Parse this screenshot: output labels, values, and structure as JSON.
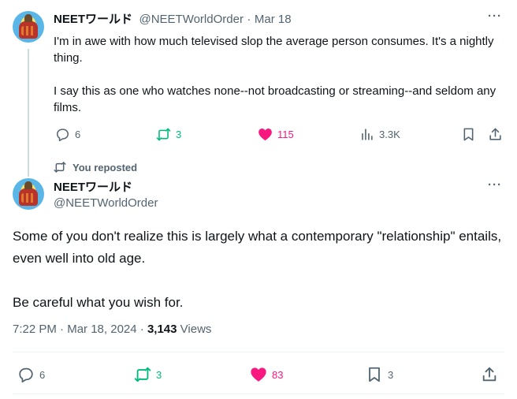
{
  "tweet1": {
    "author_name": "NEETワールド",
    "author_handle": "@NEETWorldOrder",
    "separator": "·",
    "date": "Mar 18",
    "more_icon": "more-icon",
    "paragraphs": [
      "I'm in awe with how much televised slop the average person consumes. It's a nightly thing.",
      "I say this as one who watches none--not broadcasting or streaming--and seldom any films."
    ],
    "actions": {
      "replies": "6",
      "reposts": "3",
      "likes": "115",
      "views": "3.3K"
    },
    "colors": {
      "repost": "#00ba7c",
      "like": "#f91880"
    }
  },
  "repost_note": {
    "icon": "repost-icon",
    "text": "You reposted"
  },
  "tweet2": {
    "author_name": "NEETワールド",
    "author_handle": "@NEETWorldOrder",
    "paragraphs": [
      "Some of you don't realize this is largely what a contemporary \"relationship\" entails, even well into old age.",
      "Be careful what you wish for."
    ],
    "time": "7:22 PM",
    "date": "Mar 18, 2024",
    "separator": "·",
    "views_count": "3,143",
    "views_label": "Views",
    "actions": {
      "replies": "6",
      "reposts": "3",
      "likes": "83",
      "bookmarks": "3"
    }
  }
}
